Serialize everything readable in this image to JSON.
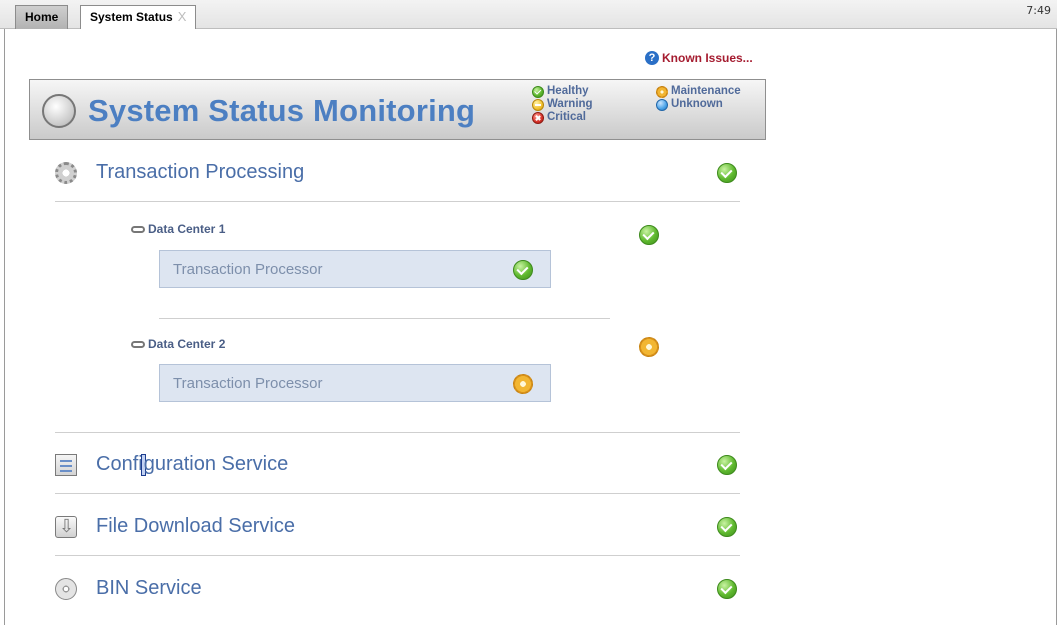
{
  "tabs": [
    {
      "label": "Home",
      "active": false
    },
    {
      "label": "System Status",
      "active": true,
      "close_glyph": "X"
    }
  ],
  "clock": "7:49",
  "known_issues": {
    "label": "Known Issues...",
    "icon": "question-icon"
  },
  "banner": {
    "title": "System Status Monitoring",
    "icon": "globe-icon",
    "legend": [
      {
        "label": "Healthy",
        "status": "healthy"
      },
      {
        "label": "Warning",
        "status": "warning"
      },
      {
        "label": "Critical",
        "status": "critical"
      },
      {
        "label": "Maintenance",
        "status": "maintenance"
      },
      {
        "label": "Unknown",
        "status": "unknown"
      }
    ]
  },
  "services": [
    {
      "label": "Transaction Processing",
      "icon": "gear-icon",
      "status": "healthy",
      "data_centers": [
        {
          "label": "Data Center 1",
          "status": "healthy",
          "components": [
            {
              "label": "Transaction Processor",
              "status": "healthy"
            }
          ]
        },
        {
          "label": "Data Center 2",
          "status": "maintenance",
          "components": [
            {
              "label": "Transaction Processor",
              "status": "maintenance"
            }
          ]
        }
      ]
    },
    {
      "label_before_caret": "Confi",
      "label_after_caret": "guration Service",
      "label": "Configuration Service",
      "icon": "checklist-icon",
      "status": "healthy"
    },
    {
      "label": "File Download Service",
      "icon": "download-icon",
      "status": "healthy"
    },
    {
      "label": "BIN Service",
      "icon": "disc-icon",
      "status": "healthy"
    }
  ],
  "colors": {
    "title_blue": "#4c7fc2",
    "link_red": "#a51c30",
    "healthy": "#5fb92f",
    "warning": "#f2c12e",
    "critical": "#d8332a",
    "maintenance": "#f2b632",
    "unknown": "#4aa3e8",
    "panel_bg": "#dde5f1"
  }
}
